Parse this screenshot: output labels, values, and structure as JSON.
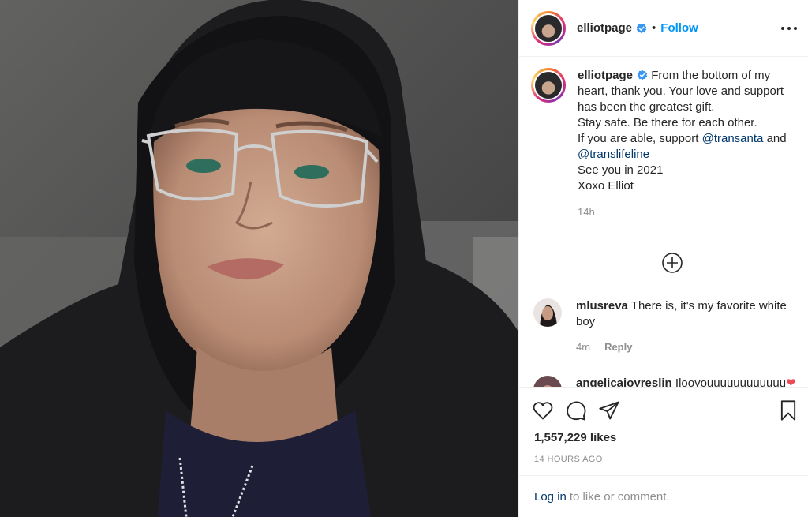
{
  "post": {
    "username": "elliotpage",
    "separator": "•",
    "follow_label": "Follow",
    "more_icon": "more-options-icon"
  },
  "caption": {
    "username": "elliotpage",
    "lines": [
      "From the bottom of my",
      "heart, thank you. Your love and support",
      "has been the greatest gift.",
      "Stay safe. Be there for each other.",
      "If you are able, support",
      "See you in 2021",
      "Xoxo Elliot"
    ],
    "mention_1": "@transanta",
    "and_word": "and",
    "mention_2": "@translifeline",
    "time": "14h"
  },
  "comments": [
    {
      "username": "mlusreva",
      "text": "There is, it's my favorite white boy",
      "time": "4m",
      "reply_label": "Reply"
    },
    {
      "username": "angelicajoyreslin",
      "text": "Ilooyouuuuuuuuuuuu",
      "emoji": "❤"
    }
  ],
  "engagement": {
    "likes": "1,557,229 likes",
    "timestamp": "14 HOURS AGO"
  },
  "login": {
    "link_label": "Log in",
    "rest": "to like or comment."
  },
  "colors": {
    "accent": "#0095f6",
    "mention": "#00376b",
    "muted": "#8e8e8e",
    "text": "#262626"
  }
}
